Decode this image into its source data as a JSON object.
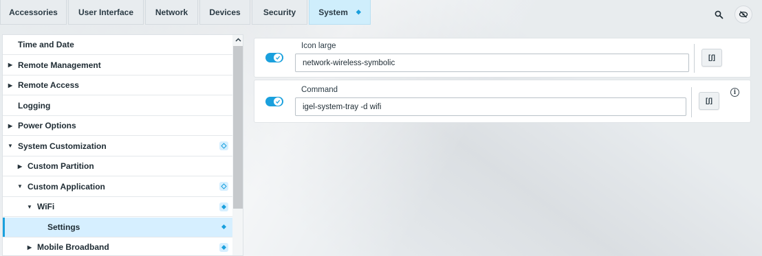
{
  "tabs": [
    {
      "label": "Accessories"
    },
    {
      "label": "User Interface"
    },
    {
      "label": "Network"
    },
    {
      "label": "Devices"
    },
    {
      "label": "Security"
    },
    {
      "label": "System",
      "active": true,
      "marker": "◆"
    }
  ],
  "top_icons": [
    "search-icon",
    "settings-eye-icon"
  ],
  "sidebar": {
    "items": [
      {
        "label": "Time and Date",
        "caret": "",
        "level": 0
      },
      {
        "label": "Remote Management",
        "caret": "▶",
        "level": 0
      },
      {
        "label": "Remote Access",
        "caret": "▶",
        "level": 0
      },
      {
        "label": "Logging",
        "caret": "",
        "level": 0
      },
      {
        "label": "Power Options",
        "caret": "▶",
        "level": 0
      },
      {
        "label": "System Customization",
        "caret": "▼",
        "level": 0,
        "mark": "outline"
      },
      {
        "label": "Custom Partition",
        "caret": "▶",
        "level": 1
      },
      {
        "label": "Custom Application",
        "caret": "▼",
        "level": 1,
        "mark": "outline"
      },
      {
        "label": "WiFi",
        "caret": "▼",
        "level": 2,
        "mark": "filled"
      },
      {
        "label": "Settings",
        "caret": "",
        "level": 3,
        "mark": "filled",
        "selected": true
      },
      {
        "label": "Mobile Broadband",
        "caret": "▶",
        "level": 2,
        "mark": "filled"
      }
    ]
  },
  "settings": {
    "icon_large": {
      "label": "Icon large",
      "value": "network-wireless-symbolic",
      "enabled": true,
      "script_button": "[ʃ]"
    },
    "command": {
      "label": "Command",
      "value": "igel-system-tray -d wifi",
      "enabled": true,
      "script_button": "[ʃ]",
      "info": "i"
    }
  },
  "colors": {
    "accent": "#1aa0dd",
    "selected_row": "#d6efff",
    "active_tab": "#cfeefc"
  }
}
